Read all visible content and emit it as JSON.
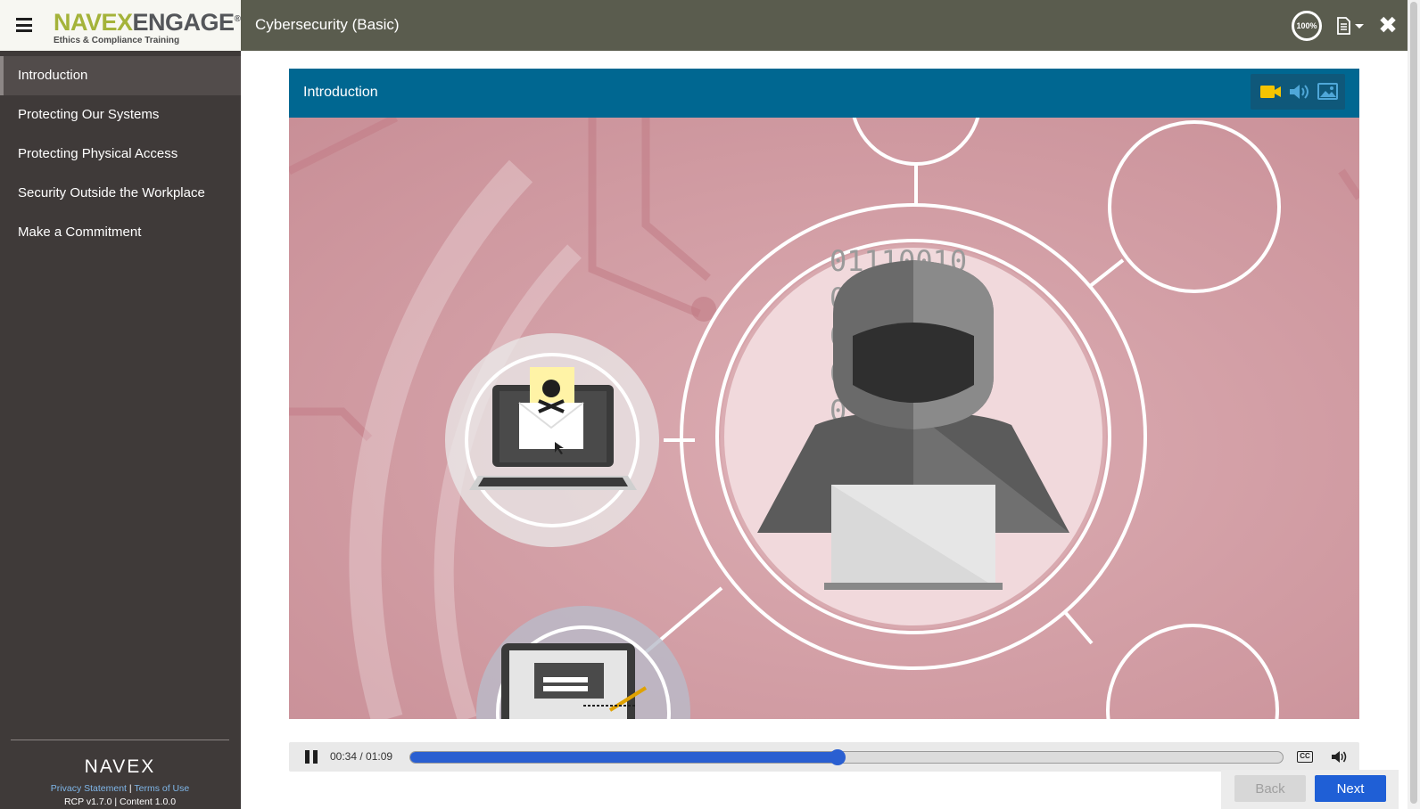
{
  "brand": {
    "logo_part_a": "NAVEX",
    "logo_part_b": "ENGAGE",
    "logo_mark": "®",
    "tagline": "Ethics & Compliance Training",
    "menu_icon": "hamburger-icon"
  },
  "header": {
    "course_title": "Cybersecurity (Basic)",
    "progress_text": "100%",
    "doc_icon": "document-icon",
    "close_icon": "close-icon"
  },
  "sidebar": {
    "items": [
      {
        "label": "Introduction",
        "active": true
      },
      {
        "label": "Protecting Our Systems",
        "active": false
      },
      {
        "label": "Protecting Physical Access",
        "active": false
      },
      {
        "label": "Security Outside the Workplace",
        "active": false
      },
      {
        "label": "Make a Commitment",
        "active": false
      }
    ],
    "footer": {
      "logo": "NAVEX",
      "privacy_link": "Privacy Statement",
      "separator": "|",
      "terms_link": "Terms of Use",
      "version": "RCP v1.7.0 | Content 1.0.0"
    }
  },
  "panel": {
    "title": "Introduction",
    "tools": {
      "video_icon": "video-camera-icon",
      "audio_icon": "speaker-icon",
      "image_icon": "image-icon"
    }
  },
  "stage": {
    "binary_text": "01110010",
    "binary_text_2": "01",
    "binary_text_3": "01",
    "binary_text_4": "01",
    "binary_text_5": "01"
  },
  "player": {
    "time": "00:34 / 01:09",
    "progress": 0.49,
    "cc_label": "CC",
    "pause_icon": "pause-icon",
    "volume_icon": "volume-icon"
  },
  "nav_buttons": {
    "back_label": "Back",
    "next_label": "Next"
  },
  "colors": {
    "sidebar_bg": "#3f3a39",
    "topbar_bg": "#5a5c4e",
    "panel_header_bg": "#006791",
    "accent_blue": "#1f5fd6",
    "logo_green": "#a4b33a",
    "video_icon_active": "#f5c400"
  }
}
